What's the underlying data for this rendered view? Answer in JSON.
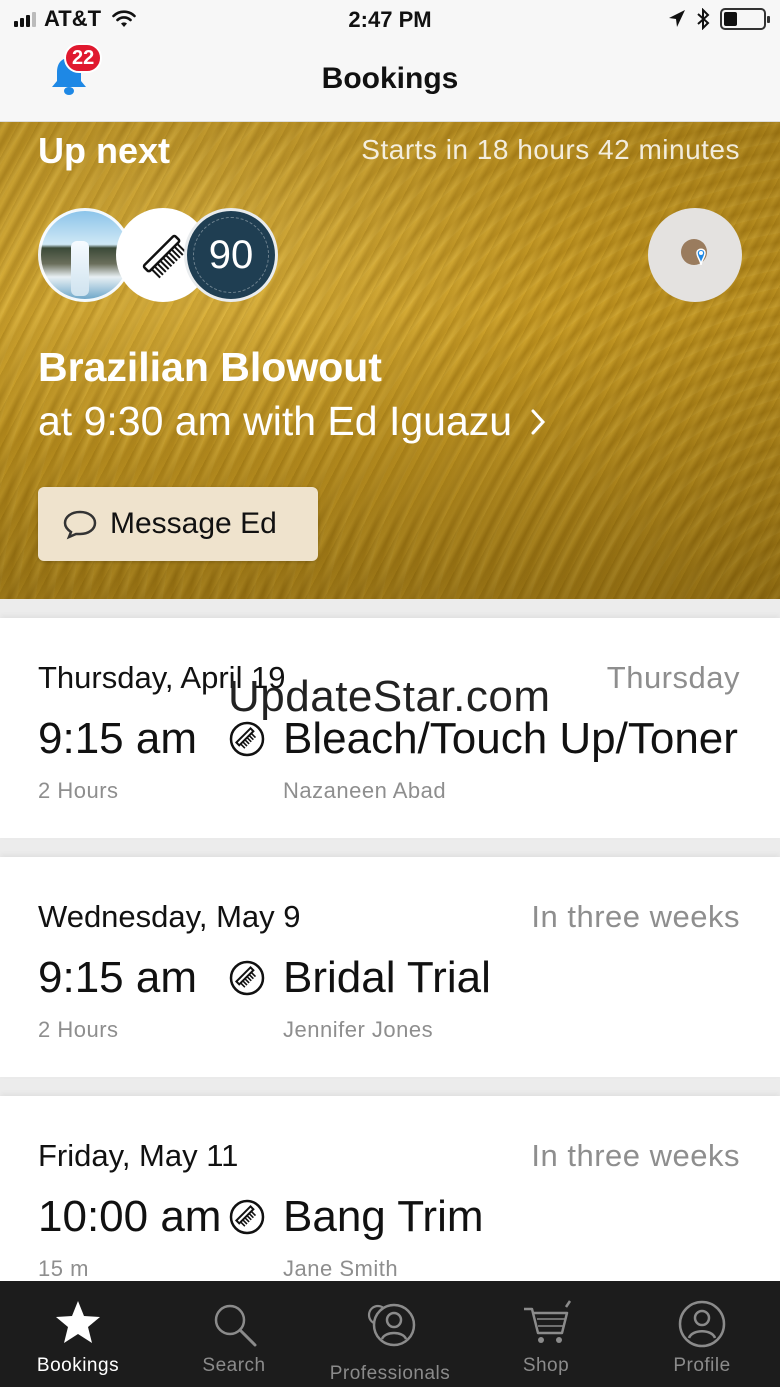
{
  "status_bar": {
    "carrier": "AT&T",
    "time": "2:47 PM",
    "battery_level": 0.35
  },
  "nav": {
    "title": "Bookings",
    "notification_count": "22"
  },
  "up_next": {
    "heading": "Up next",
    "starts_in": "Starts in 18 hours 42 minutes",
    "duration_badge": "90",
    "service": "Brazilian Blowout",
    "detail": "at 9:30 am with Ed Iguazu",
    "message_label": "Message Ed"
  },
  "bookings": [
    {
      "date": "Thursday, April 19",
      "relative": "Thursday",
      "time": "9:15 am",
      "service": "Bleach/Touch Up/Toner",
      "duration": "2 Hours",
      "stylist": "Nazaneen Abad"
    },
    {
      "date": "Wednesday, May 9",
      "relative": "In three weeks",
      "time": "9:15 am",
      "service": "Bridal Trial",
      "duration": "2 Hours",
      "stylist": "Jennifer Jones"
    },
    {
      "date": "Friday, May 11",
      "relative": "In three weeks",
      "time": "10:00 am",
      "service": "Bang Trim",
      "duration": "15 m",
      "stylist": "Jane Smith"
    }
  ],
  "watermark": "UpdateStar.com",
  "tabs": [
    {
      "label": "Bookings",
      "icon": "star-icon",
      "active": true
    },
    {
      "label": "Search",
      "icon": "search-icon",
      "active": false
    },
    {
      "label": "Professionals",
      "icon": "professionals-icon",
      "active": false
    },
    {
      "label": "Shop",
      "icon": "cart-icon",
      "active": false
    },
    {
      "label": "Profile",
      "icon": "profile-icon",
      "active": false
    }
  ],
  "colors": {
    "badge": "#e0192f",
    "bell": "#1e88e5",
    "tab_bar": "#1c1c1c",
    "hero": "#c8991f",
    "message_button": "#efe3cd",
    "duration_badge": "#1f3e52"
  }
}
